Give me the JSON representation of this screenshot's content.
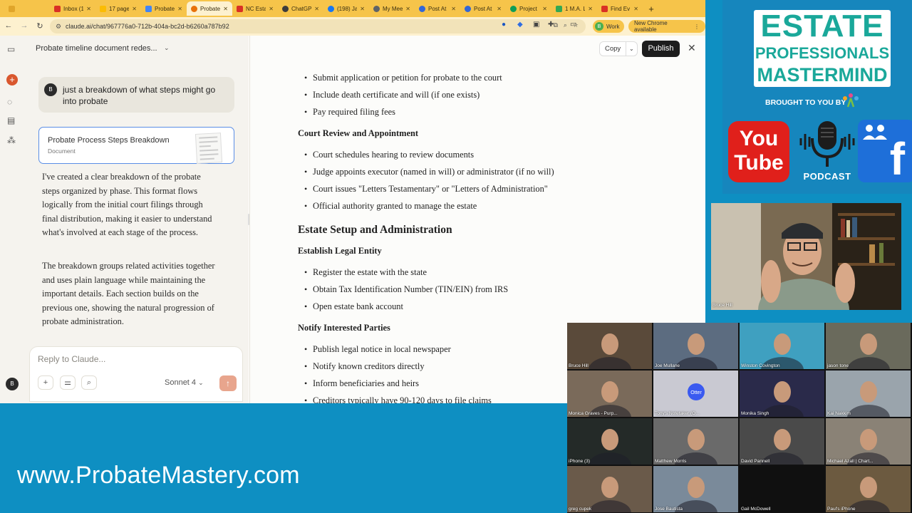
{
  "browser": {
    "tabs": [
      {
        "label": "",
        "color": "#f6c44a"
      },
      {
        "label": "Inbox (1",
        "color": "#d93025"
      },
      {
        "label": "17 page",
        "color": "#fbbc04"
      },
      {
        "label": "Probate",
        "color": "#4285f4"
      },
      {
        "label": "Probate",
        "color": "#e8710a",
        "active": true
      },
      {
        "label": "NC Esta",
        "color": "#d93025"
      },
      {
        "label": "ChatGP",
        "color": "#3c3c3c"
      },
      {
        "label": "(198) Ja",
        "color": "#1877f2"
      },
      {
        "label": "My Mee",
        "color": "#5f6368"
      },
      {
        "label": "Post At",
        "color": "#3367d6"
      },
      {
        "label": "Post At",
        "color": "#3367d6"
      },
      {
        "label": "Project",
        "color": "#0f9d58"
      },
      {
        "label": "1 M.A. L",
        "color": "#34a853"
      },
      {
        "label": "Find Ev",
        "color": "#d93025"
      }
    ],
    "url": "claude.ai/chat/967776a0-712b-404a-bc2d-b6260a787b92",
    "work_label": "Work",
    "work_initial": "B",
    "chrome_available": "New Chrome available"
  },
  "sidebar": {
    "avatar_initial": "B"
  },
  "chat": {
    "title": "Probate timeline document redes...",
    "user_initial": "B",
    "user_message": "just a breakdown of what steps might go into probate",
    "doc_card": {
      "title": "Probate Process Steps Breakdown",
      "type": "Document"
    },
    "reply_paragraphs": [
      "I've created a clear breakdown of the probate steps organized by phase. This format flows logically from the initial court filings through final distribution, making it easier to understand what's involved at each stage of the process.",
      "The breakdown groups related activities together and uses plain language while maintaining the important details. Each section builds on the previous one, showing the natural progression of probate administration."
    ],
    "composer": {
      "placeholder": "Reply to Claude...",
      "model": "Sonnet 4"
    }
  },
  "artifact": {
    "copy_label": "Copy",
    "publish_label": "Publish",
    "lines": [
      {
        "kind": "bullet",
        "text": "Submit application or petition for probate to the court"
      },
      {
        "kind": "bullet",
        "text": "Include death certificate and will (if one exists)"
      },
      {
        "kind": "bullet",
        "text": "Pay required filing fees"
      },
      {
        "kind": "sub",
        "text": "Court Review and Appointment"
      },
      {
        "kind": "bullet",
        "text": "Court schedules hearing to review documents"
      },
      {
        "kind": "bullet",
        "text": "Judge appoints executor (named in will) or administrator (if no will)"
      },
      {
        "kind": "bullet",
        "text": "Court issues \"Letters Testamentary\" or \"Letters of Administration\""
      },
      {
        "kind": "bullet",
        "text": "Official authority granted to manage the estate"
      },
      {
        "kind": "section",
        "text": "Estate Setup and Administration"
      },
      {
        "kind": "sub",
        "text": "Establish Legal Entity"
      },
      {
        "kind": "bullet",
        "text": "Register the estate with the state"
      },
      {
        "kind": "bullet",
        "text": "Obtain Tax Identification Number (TIN/EIN) from IRS"
      },
      {
        "kind": "bullet",
        "text": "Open estate bank account"
      },
      {
        "kind": "sub",
        "text": "Notify Interested Parties"
      },
      {
        "kind": "bullet",
        "text": "Publish legal notice in local newspaper"
      },
      {
        "kind": "bullet",
        "text": "Notify known creditors directly"
      },
      {
        "kind": "bullet",
        "text": "Inform beneficiaries and heirs"
      },
      {
        "kind": "bullet",
        "text": "Creditors typically have 90-120 days to file claims"
      }
    ]
  },
  "banner": {
    "line1": "ESTATE",
    "line2": "PROFESSIONALS",
    "line3": "MASTERMIND",
    "brought_by": "BROUGHT TO YOU BY",
    "youtube_1": "You",
    "youtube_2": "Tube",
    "podcast": "PODCAST",
    "facebook": "f"
  },
  "speaker": {
    "name": "Bruce Hill"
  },
  "participants": [
    {
      "name": "Bruce Hill",
      "bg": "#5a4a3a"
    },
    {
      "name": "Joe Mullane",
      "bg": "#5c6c80"
    },
    {
      "name": "Winston Covington",
      "bg": "#3fa0c0"
    },
    {
      "name": "jason tone",
      "bg": "#6a6a5c"
    },
    {
      "name": "Monica Graves - Purp...",
      "bg": "#7a6a5a"
    },
    {
      "name": "Tony's Notetaker (O...",
      "bg": "#c9c9d2"
    },
    {
      "name": "Monika Singh",
      "bg": "#2a2a4a"
    },
    {
      "name": "Kai Nakkim",
      "bg": "#9aa4ac"
    },
    {
      "name": "iPhone (3)",
      "bg": "#242a28"
    },
    {
      "name": "Matthew Morris",
      "bg": "#6a6a6a"
    },
    {
      "name": "David Pannell",
      "bg": "#4a4a4a"
    },
    {
      "name": "Michael Azall | Chart...",
      "bg": "#8a8276"
    },
    {
      "name": "greg cupek",
      "bg": "#6a5a4a"
    },
    {
      "name": "Jose Bautista",
      "bg": "#7a8a9a"
    },
    {
      "name": "Gail McDowell",
      "bg": "#101010"
    },
    {
      "name": "Paul's iPhone",
      "bg": "#6c5a40"
    }
  ],
  "footer": {
    "site": "www.ProbateMastery.com"
  },
  "colors": {
    "accent_blue": "#0e8fc2",
    "tabbar_yellow": "#f6c44a",
    "claude_orange": "#d9572e"
  }
}
